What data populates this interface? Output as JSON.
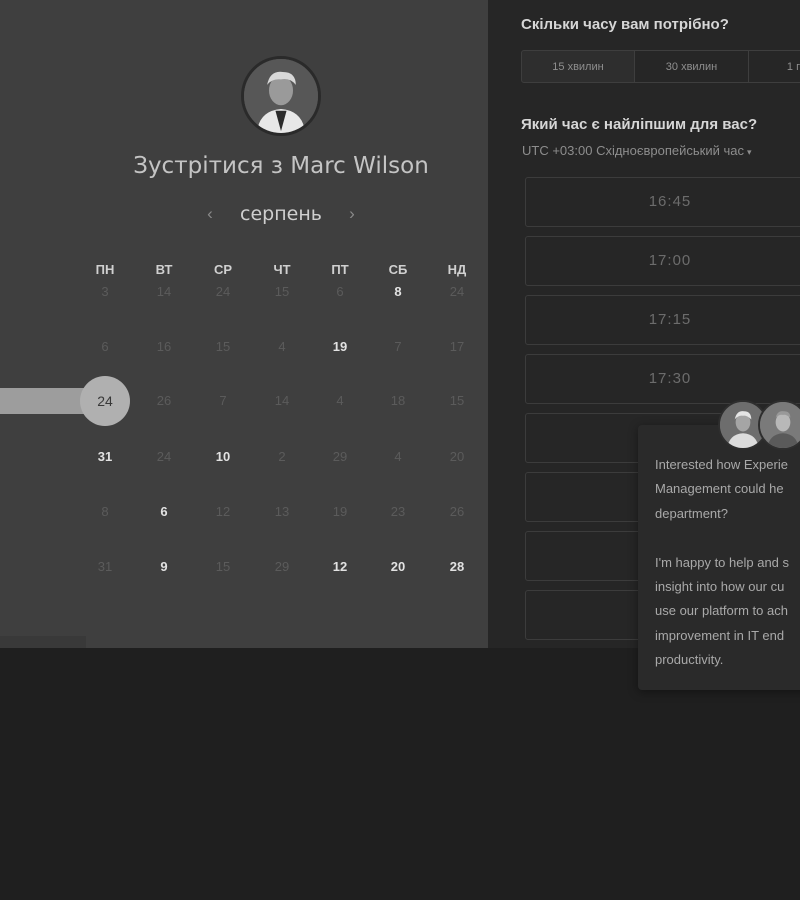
{
  "booking": {
    "title": "Зустрітися з Marc Wilson",
    "month": "серпень",
    "weekdays": [
      "ПН",
      "ВТ",
      "СР",
      "ЧТ",
      "ПТ",
      "СБ",
      "НД"
    ],
    "weeks": [
      {
        "days": [
          {
            "n": "3",
            "a": false
          },
          {
            "n": "14",
            "a": false
          },
          {
            "n": "24",
            "a": false
          },
          {
            "n": "15",
            "a": false
          },
          {
            "n": "6",
            "a": false
          },
          {
            "n": "8",
            "a": true
          },
          {
            "n": "24",
            "a": false
          }
        ]
      },
      {
        "days": [
          {
            "n": "6",
            "a": false
          },
          {
            "n": "16",
            "a": false
          },
          {
            "n": "15",
            "a": false
          },
          {
            "n": "4",
            "a": false
          },
          {
            "n": "19",
            "a": true
          },
          {
            "n": "7",
            "a": false
          },
          {
            "n": "17",
            "a": false
          }
        ]
      },
      {
        "days": [
          {
            "n": "24",
            "a": false,
            "sel": true
          },
          {
            "n": "26",
            "a": false
          },
          {
            "n": "7",
            "a": false
          },
          {
            "n": "14",
            "a": false
          },
          {
            "n": "4",
            "a": false
          },
          {
            "n": "18",
            "a": false
          },
          {
            "n": "15",
            "a": false
          }
        ]
      },
      {
        "days": [
          {
            "n": "31",
            "a": true
          },
          {
            "n": "24",
            "a": false
          },
          {
            "n": "10",
            "a": true
          },
          {
            "n": "2",
            "a": false
          },
          {
            "n": "29",
            "a": false
          },
          {
            "n": "4",
            "a": false
          },
          {
            "n": "20",
            "a": false
          }
        ]
      },
      {
        "days": [
          {
            "n": "8",
            "a": false
          },
          {
            "n": "6",
            "a": true
          },
          {
            "n": "12",
            "a": false
          },
          {
            "n": "13",
            "a": false
          },
          {
            "n": "19",
            "a": false
          },
          {
            "n": "23",
            "a": false
          },
          {
            "n": "26",
            "a": false
          }
        ]
      },
      {
        "days": [
          {
            "n": "31",
            "a": false
          },
          {
            "n": "9",
            "a": true
          },
          {
            "n": "15",
            "a": false
          },
          {
            "n": "29",
            "a": false
          },
          {
            "n": "12",
            "a": true
          },
          {
            "n": "20",
            "a": true
          },
          {
            "n": "28",
            "a": true
          }
        ]
      }
    ],
    "selected_day": "24"
  },
  "schedule": {
    "duration_question": "Скільки часу вам потрібно?",
    "durations": [
      "15 хвилин",
      "30 хвилин",
      "1 г"
    ],
    "time_question": "Який час є найліпшим для вас?",
    "timezone": "UTC +03:00 Східноєвропейський час",
    "slots": [
      "16:45",
      "17:00",
      "17:15",
      "17:30",
      "",
      "",
      "",
      ""
    ]
  },
  "chat": {
    "message": "Interested how Experie\nManagement could he\ndepartment?\n\nI'm happy to help and s\ninsight into how our cu\nuse our platform to ach\nimprovement in IT end\nproductivity."
  },
  "colors": {
    "left_panel": "#3f3f3f",
    "right_panel": "#262626",
    "page_bg": "#1f1f1f",
    "selected_day": "#b0b0b0"
  }
}
